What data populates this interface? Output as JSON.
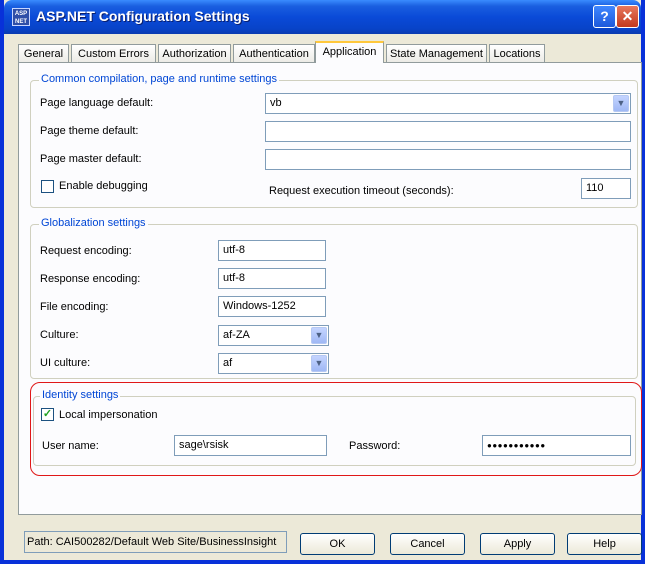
{
  "window": {
    "title": "ASP.NET Configuration Settings",
    "icon_text": "ASP NET",
    "help_glyph": "?",
    "close_glyph": "✕"
  },
  "tabs": [
    {
      "label": "General"
    },
    {
      "label": "Custom Errors"
    },
    {
      "label": "Authorization"
    },
    {
      "label": "Authentication"
    },
    {
      "label": "Application",
      "active": true
    },
    {
      "label": "State Management"
    },
    {
      "label": "Locations"
    }
  ],
  "compilation": {
    "legend": "Common compilation, page and runtime settings",
    "page_language_label": "Page language default:",
    "page_language_value": "vb",
    "page_theme_label": "Page theme default:",
    "page_theme_value": "",
    "page_master_label": "Page master default:",
    "page_master_value": "",
    "enable_debugging_label": "Enable debugging",
    "enable_debugging_checked": false,
    "timeout_label": "Request execution timeout (seconds):",
    "timeout_value": "110"
  },
  "globalization": {
    "legend": "Globalization settings",
    "request_encoding_label": "Request encoding:",
    "request_encoding_value": "utf-8",
    "response_encoding_label": "Response encoding:",
    "response_encoding_value": "utf-8",
    "file_encoding_label": "File encoding:",
    "file_encoding_value": "Windows-1252",
    "culture_label": "Culture:",
    "culture_value": "af-ZA",
    "ui_culture_label": "UI culture:",
    "ui_culture_value": "af"
  },
  "identity": {
    "legend": "Identity settings",
    "local_impersonation_label": "Local impersonation",
    "local_impersonation_checked": true,
    "username_label": "User name:",
    "username_value": "sage\\rsisk",
    "password_label": "Password:",
    "password_value": "●●●●●●●●●●●"
  },
  "footer": {
    "path": "Path: CAI500282/Default Web Site/BusinessInsight",
    "ok": "OK",
    "cancel": "Cancel",
    "apply": "Apply",
    "help": "Help"
  },
  "colors": {
    "titlebar": "#0a4ad8",
    "legend_text": "#0046d5",
    "highlight_outline": "#e01818",
    "dialog_bg": "#ece9d8"
  },
  "icons": {
    "dropdown": "▼",
    "checkmark": "✓"
  }
}
